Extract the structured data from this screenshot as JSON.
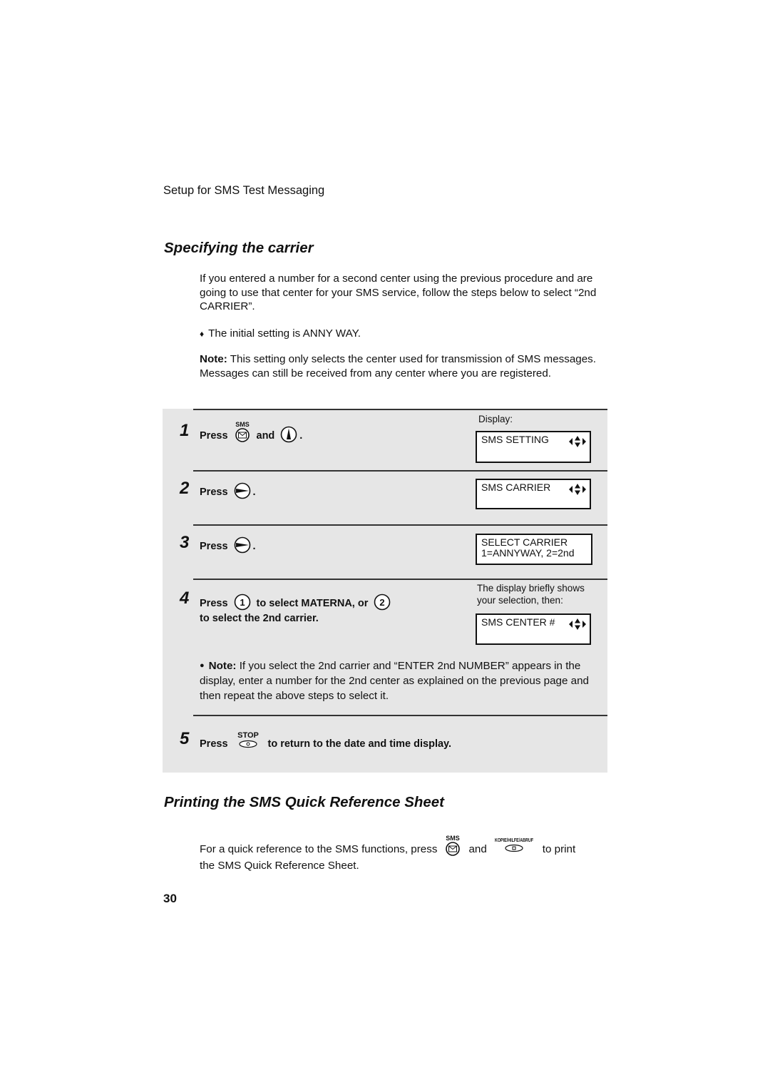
{
  "header": {
    "section_title": "Setup for SMS Test Messaging"
  },
  "specifying": {
    "title": "Specifying the carrier",
    "intro": "If you entered a number for a second center using the previous procedure and are going to use that center for your SMS service, follow the steps below to select “2nd CARRIER”.",
    "bullet_symbol": "♦",
    "bullet_text": "The initial setting is ANNY WAY.",
    "note_label": "Note:",
    "note_text": " This setting only selects the center used for transmission of SMS messages. Messages can still be received from any center where you are registered."
  },
  "steps": {
    "display_label": "Display:",
    "s1": {
      "num": "1",
      "press": "Press",
      "key1_label": "SMS",
      "and": "and",
      "end": ".",
      "lcd": "SMS SETTING"
    },
    "s2": {
      "num": "2",
      "press": "Press",
      "end": ".",
      "lcd": "SMS CARRIER"
    },
    "s3": {
      "num": "3",
      "press": "Press",
      "end": ".",
      "lcd_line1": "SELECT CARRIER",
      "lcd_line2": "1=ANNYWAY, 2=2nd"
    },
    "s4": {
      "num": "4",
      "press": "Press",
      "key1": "1",
      "mid": "to select MATERNA, or",
      "key2": "2",
      "line2": "to select the 2nd carrier.",
      "display_note": "The display briefly shows your selection, then:",
      "lcd": "SMS CENTER #"
    },
    "note": {
      "bullet": "●",
      "label": "Note:",
      "text": " If you select the 2nd carrier and “ENTER 2nd NUMBER” appears in the display, enter a number for the 2nd center as explained on the previous page and then repeat the above steps to select it."
    },
    "s5": {
      "num": "5",
      "press": "Press",
      "key_label": "STOP",
      "text": "to return to the date and time display."
    }
  },
  "printing": {
    "title": "Printing the SMS Quick Reference Sheet",
    "line1_pre": "For a quick reference to the SMS functions, press",
    "key1_label": "SMS",
    "and": "and",
    "key2_label": "KOPIE/HILFE/ABRUF",
    "line1_post": "to print",
    "line2": "the SMS Quick Reference Sheet."
  },
  "page_number": "30"
}
